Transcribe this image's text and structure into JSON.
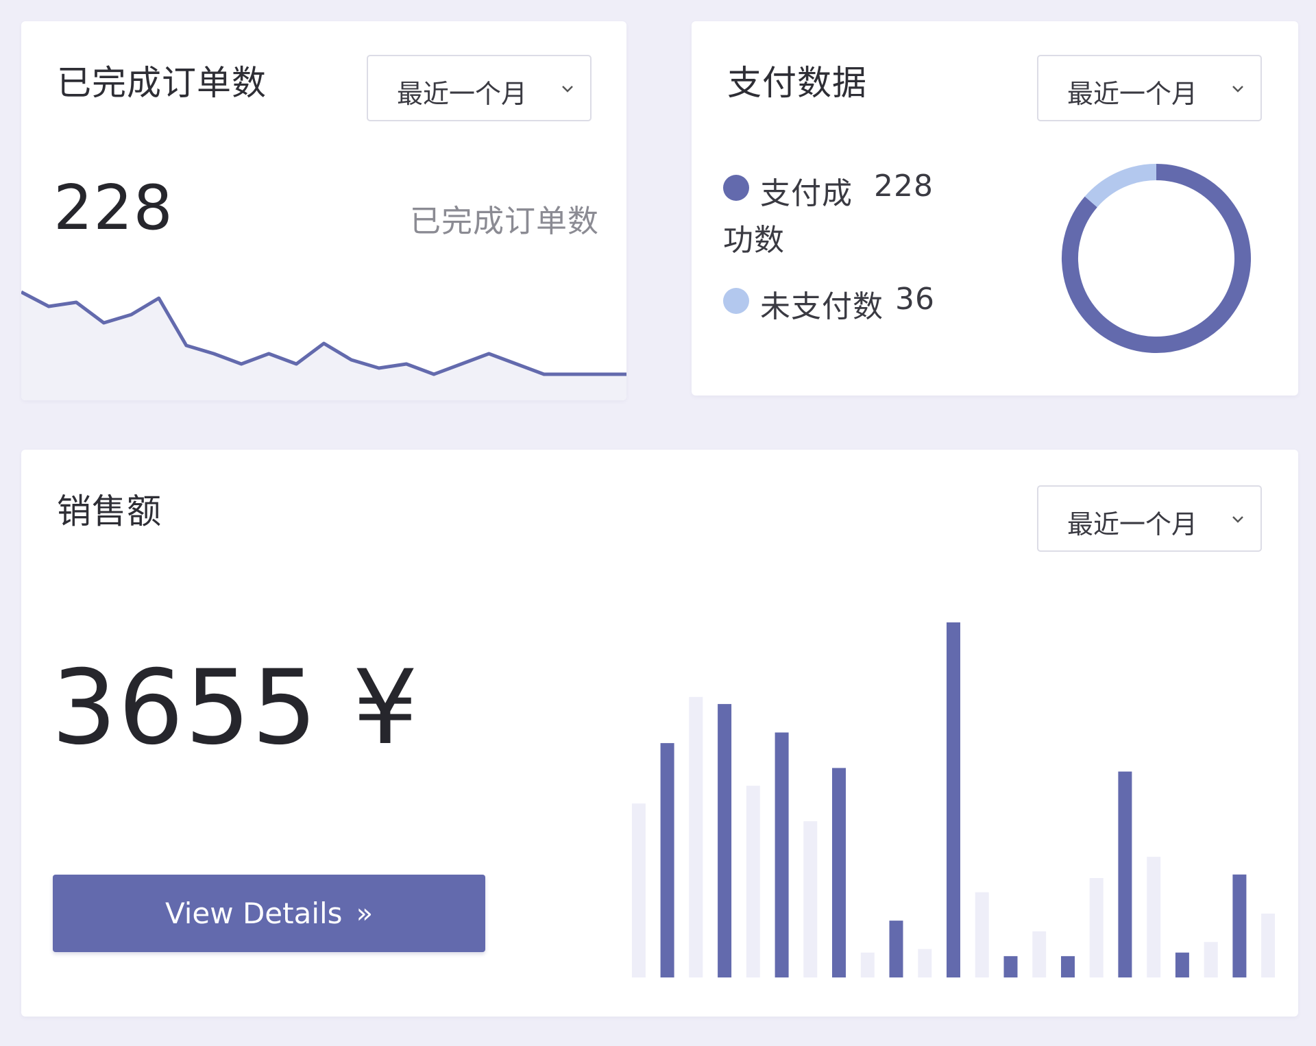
{
  "orders_card": {
    "title": "已完成订单数",
    "select_value": "最近一个月",
    "count": "228",
    "caption": "已完成订单数",
    "sparkline_color": "#636aad",
    "sparkline_values": [
      100,
      86,
      90,
      70,
      78,
      94,
      48,
      40,
      30,
      40,
      30,
      50,
      34,
      26,
      30,
      20,
      30,
      40,
      30,
      20,
      20,
      20,
      20
    ]
  },
  "payment_card": {
    "title": "支付数据",
    "select_value": "最近一个月",
    "legend": {
      "paid_label_line1": "支付成",
      "paid_label_line2": "功数",
      "paid_value": "228",
      "unpaid_label": "未支付数",
      "unpaid_value": "36"
    },
    "colors": {
      "paid": "#636aad",
      "unpaid": "#b3c8ee"
    },
    "chart_data": {
      "type": "pie",
      "values": [
        228,
        36
      ]
    }
  },
  "sales_card": {
    "title": "销售额",
    "select_value": "最近一个月",
    "amount": "3655 ¥",
    "button_label": "View Details",
    "button_icon": "double-chevron-right-icon",
    "colors": {
      "primary": "#636aad",
      "secondary": "#eeeef8"
    },
    "chart_data": {
      "type": "bar",
      "series": [
        {
          "values": [
            0,
            66,
            0,
            77,
            0,
            69,
            0,
            59,
            0,
            16,
            0,
            100,
            0,
            6,
            0,
            6,
            0,
            58,
            0,
            7,
            0,
            29,
            0
          ]
        },
        {
          "values": [
            49,
            0,
            79,
            0,
            54,
            0,
            44,
            0,
            7,
            0,
            8,
            0,
            24,
            0,
            13,
            0,
            28,
            0,
            34,
            0,
            10,
            0,
            18
          ]
        }
      ]
    }
  }
}
